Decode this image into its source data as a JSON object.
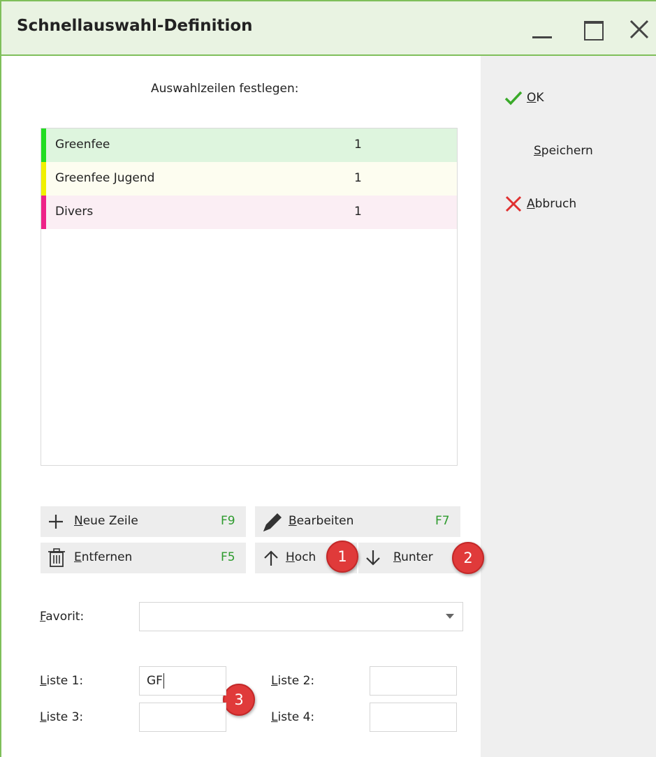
{
  "window": {
    "title": "Schnellauswahl-Definition"
  },
  "side": {
    "ok": "OK",
    "save": "Speichern",
    "cancel": "Abbruch"
  },
  "heading": "Auswahlzeilen festlegen:",
  "list": {
    "rows": [
      {
        "name": "Greenfee",
        "qty": "1",
        "bar_color": "#22dd22",
        "bg": "#def5de"
      },
      {
        "name": "Greenfee Jugend",
        "qty": "1",
        "bar_color": "#f0f000",
        "bg": "#fdfdf0"
      },
      {
        "name": "Divers",
        "qty": "1",
        "bar_color": "#ee2288",
        "bg": "#fbeef4"
      }
    ]
  },
  "toolbar": {
    "new_row": "Neue Zeile",
    "new_row_key": "F9",
    "edit": "Bearbeiten",
    "edit_key": "F7",
    "remove": "Entfernen",
    "remove_key": "F5",
    "up": "Hoch",
    "down": "Runter"
  },
  "badges": [
    "1",
    "2",
    "3"
  ],
  "form": {
    "favorite_label": "Favorit:",
    "favorite_value": "",
    "list1_label": "Liste 1:",
    "list1_value": "GF",
    "list2_label": "Liste 2:",
    "list2_value": "",
    "list3_label": "Liste 3:",
    "list3_value": "",
    "list4_label": "Liste 4:",
    "list4_value": ""
  },
  "colors": {
    "accent_green": "#7fbf5a",
    "hotkey_green": "#2e9b2e",
    "badge_red": "#e03a3a"
  }
}
